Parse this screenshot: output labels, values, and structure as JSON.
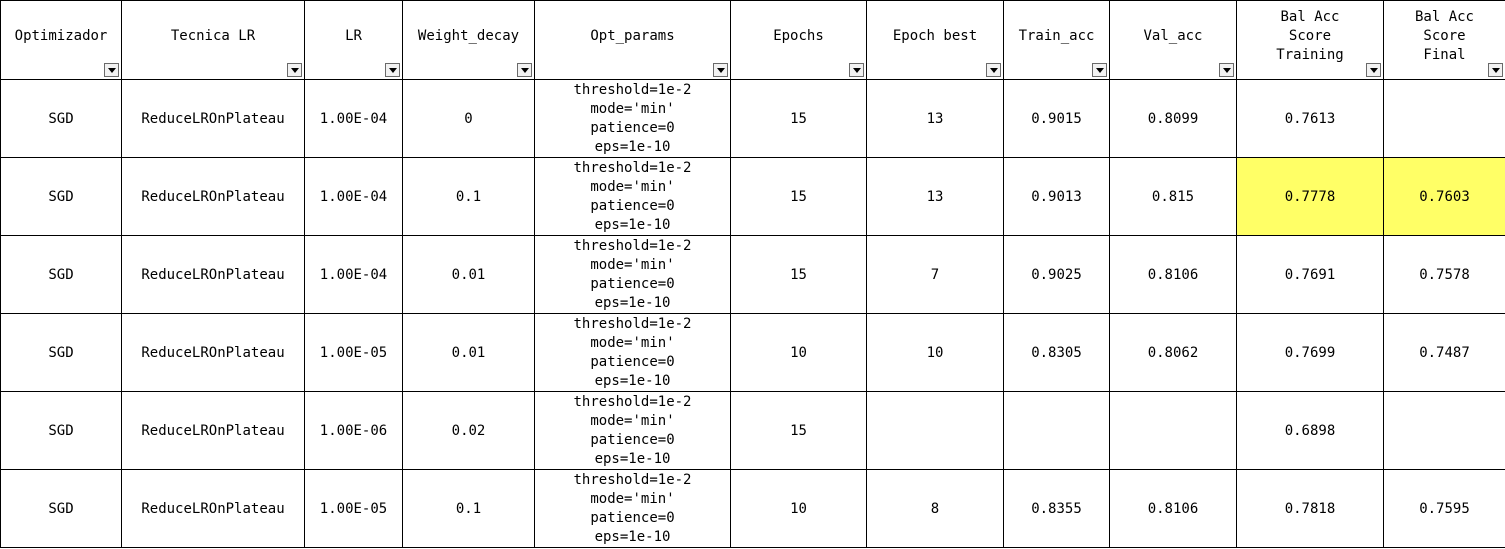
{
  "colors": {
    "highlight": "#ffff66",
    "grid": "#000000"
  },
  "columns": [
    {
      "label": "Optimizador"
    },
    {
      "label": "Tecnica LR"
    },
    {
      "label": "LR"
    },
    {
      "label": "Weight_decay"
    },
    {
      "label": "Opt_params"
    },
    {
      "label": "Epochs"
    },
    {
      "label": "Epoch best"
    },
    {
      "label": "Train_acc"
    },
    {
      "label": "Val_acc"
    },
    {
      "label": "Bal Acc\nScore\nTraining"
    },
    {
      "label": "Bal Acc\nScore\nFinal"
    }
  ],
  "filter_icon": "dropdown-arrow-icon",
  "rows": [
    {
      "cells": [
        "SGD",
        "ReduceLROnPlateau",
        "1.00E-04",
        "0",
        "threshold=1e-2\nmode='min'\npatience=0\neps=1e-10",
        "15",
        "13",
        "0.9015",
        "0.8099",
        "0.7613",
        ""
      ],
      "highlight": [
        false,
        false,
        false,
        false,
        false,
        false,
        false,
        false,
        false,
        false,
        false
      ]
    },
    {
      "cells": [
        "SGD",
        "ReduceLROnPlateau",
        "1.00E-04",
        "0.1",
        "threshold=1e-2\nmode='min'\npatience=0\neps=1e-10",
        "15",
        "13",
        "0.9013",
        "0.815",
        "0.7778",
        "0.7603"
      ],
      "highlight": [
        false,
        false,
        false,
        false,
        false,
        false,
        false,
        false,
        false,
        true,
        true
      ]
    },
    {
      "cells": [
        "SGD",
        "ReduceLROnPlateau",
        "1.00E-04",
        "0.01",
        "threshold=1e-2\nmode='min'\npatience=0\neps=1e-10",
        "15",
        "7",
        "0.9025",
        "0.8106",
        "0.7691",
        "0.7578"
      ],
      "highlight": [
        false,
        false,
        false,
        false,
        false,
        false,
        false,
        false,
        false,
        false,
        false
      ]
    },
    {
      "cells": [
        "SGD",
        "ReduceLROnPlateau",
        "1.00E-05",
        "0.01",
        "threshold=1e-2\nmode='min'\npatience=0\neps=1e-10",
        "10",
        "10",
        "0.8305",
        "0.8062",
        "0.7699",
        "0.7487"
      ],
      "highlight": [
        false,
        false,
        false,
        false,
        false,
        false,
        false,
        false,
        false,
        false,
        false
      ]
    },
    {
      "cells": [
        "SGD",
        "ReduceLROnPlateau",
        "1.00E-06",
        "0.02",
        "threshold=1e-2\nmode='min'\npatience=0\neps=1e-10",
        "15",
        "",
        "",
        "",
        "0.6898",
        ""
      ],
      "highlight": [
        false,
        false,
        false,
        false,
        false,
        false,
        false,
        false,
        false,
        false,
        false
      ]
    },
    {
      "cells": [
        "SGD",
        "ReduceLROnPlateau",
        "1.00E-05",
        "0.1",
        "threshold=1e-2\nmode='min'\npatience=0\neps=1e-10",
        "10",
        "8",
        "0.8355",
        "0.8106",
        "0.7818",
        "0.7595"
      ],
      "highlight": [
        false,
        false,
        false,
        false,
        false,
        false,
        false,
        false,
        false,
        false,
        false
      ]
    }
  ]
}
